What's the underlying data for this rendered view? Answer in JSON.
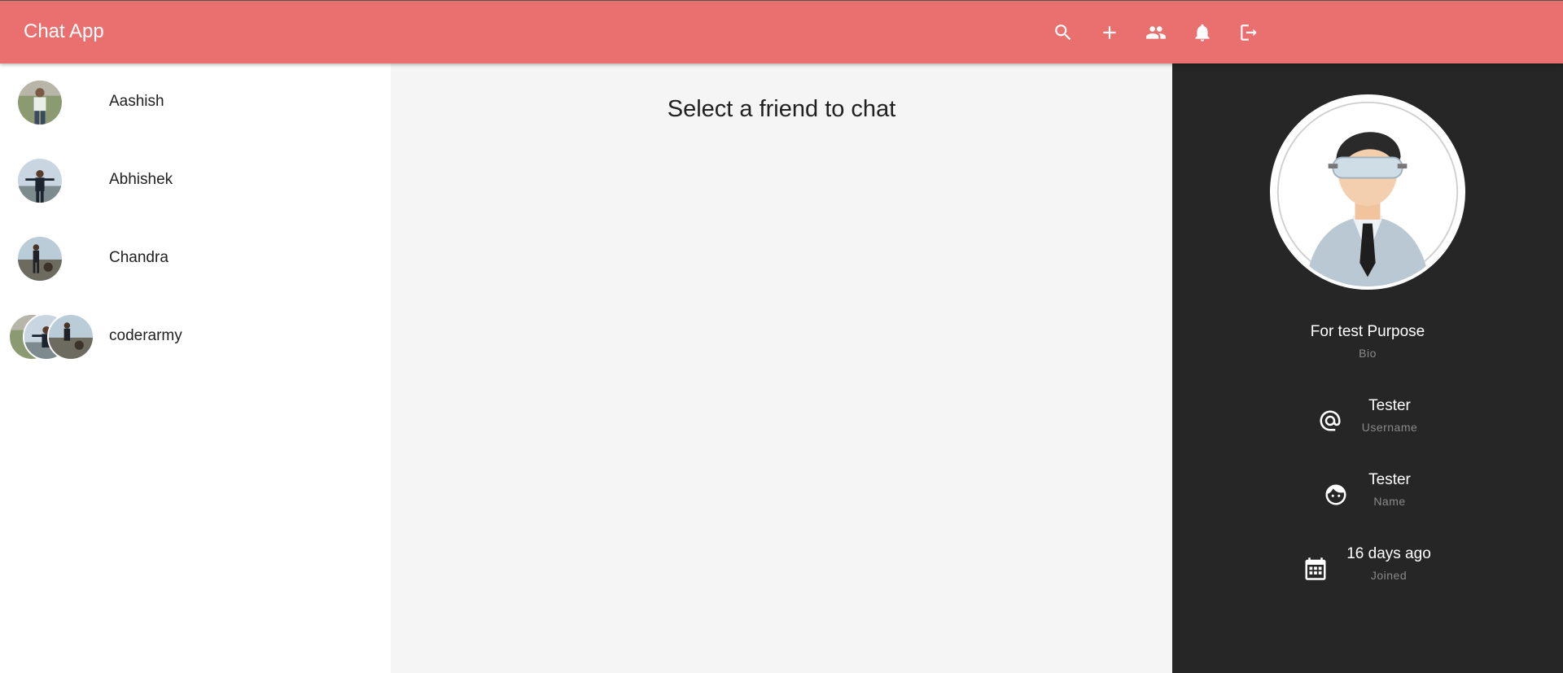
{
  "app": {
    "title": "Chat App"
  },
  "toolbar": {
    "actions": [
      {
        "icon": "search-icon"
      },
      {
        "icon": "plus-icon"
      },
      {
        "icon": "group-icon"
      },
      {
        "icon": "bell-icon"
      },
      {
        "icon": "logout-icon"
      }
    ]
  },
  "friends": [
    {
      "name": "Aashish"
    },
    {
      "name": "Abhishek"
    },
    {
      "name": "Chandra"
    },
    {
      "name": "coderarmy"
    }
  ],
  "main": {
    "prompt": "Select a friend to chat"
  },
  "profile": {
    "bio": {
      "value": "For test Purpose",
      "label": "Bio"
    },
    "username": {
      "value": "Tester",
      "label": "Username"
    },
    "name": {
      "value": "Tester",
      "label": "Name"
    },
    "joined": {
      "value": "16 days ago",
      "label": "Joined"
    }
  },
  "colors": {
    "appbar": "#ea7070",
    "profile_bg": "#262626",
    "main_bg": "#f5f5f5"
  }
}
